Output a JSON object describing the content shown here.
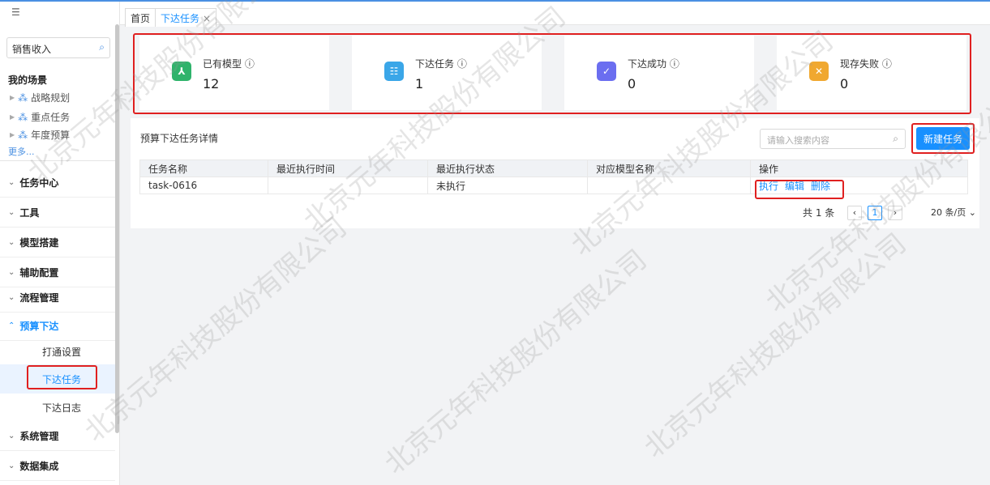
{
  "sidebar": {
    "menu_icon": "menu-fold-icon",
    "search_value": "销售收入",
    "scene_title": "我的场景",
    "scenes": [
      "战略规划",
      "重点任务",
      "年度预算"
    ],
    "more": "更多...",
    "nav": [
      {
        "label": "任务中心"
      },
      {
        "label": "工具"
      },
      {
        "label": "模型搭建"
      },
      {
        "label": "辅助配置"
      },
      {
        "label": "流程管理"
      },
      {
        "label": "预算下达"
      },
      {
        "label": "系统管理"
      },
      {
        "label": "数据集成"
      }
    ],
    "sub_items": [
      "打通设置",
      "下达任务",
      "下达日志"
    ]
  },
  "tabs": {
    "home": "首页",
    "current": "下达任务",
    "close": "×"
  },
  "stats": [
    {
      "label": "已有模型 ⓘ",
      "value": "12",
      "color": "#2fb36b",
      "icon": "model-icon"
    },
    {
      "label": "下达任务 ⓘ",
      "value": "1",
      "color": "#3aa6e8",
      "icon": "task-list-icon"
    },
    {
      "label": "下达成功 ⓘ",
      "value": "0",
      "color": "#6b6ef0",
      "icon": "check-icon"
    },
    {
      "label": "现存失败 ⓘ",
      "value": "0",
      "color": "#f0a830",
      "icon": "close-icon"
    }
  ],
  "detail": {
    "title": "预算下达任务详情",
    "search_placeholder": "请输入搜索内容",
    "new_button": "新建任务"
  },
  "table": {
    "headers": [
      "任务名称",
      "最近执行时间",
      "最近执行状态",
      "对应模型名称",
      "操作"
    ],
    "rows": [
      {
        "name": "task-0616",
        "time": "",
        "status": "未执行",
        "model": "",
        "ops": [
          "执行",
          "编辑",
          "删除"
        ]
      }
    ]
  },
  "pager": {
    "total": "共 1 条",
    "prev": "‹",
    "page": "1",
    "next": "›",
    "size": "20 条/页 ⌄"
  },
  "watermark": "北京元年科技股份有限公司"
}
